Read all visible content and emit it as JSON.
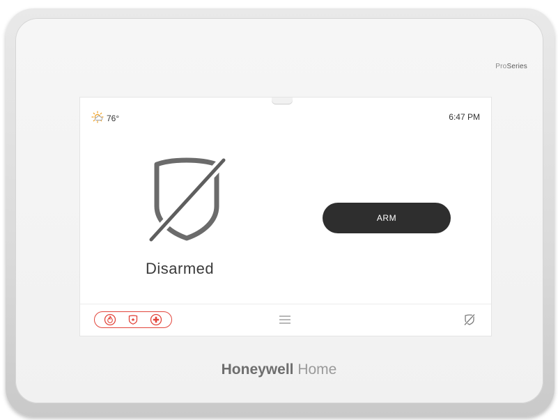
{
  "device": {
    "model_prefix": "Pro",
    "model_suffix": "Series",
    "brand_strong": "Honeywell",
    "brand_light": " Home"
  },
  "screen": {
    "weather": {
      "icon": "sun-cloud-icon",
      "temperature": "76°"
    },
    "time": "6:47 PM",
    "status": {
      "icon": "disarmed-shield-icon",
      "label": "Disarmed"
    },
    "arm_button": {
      "label": "ARM"
    },
    "bottom_bar": {
      "emergency_buttons": [
        {
          "icon": "fire-icon"
        },
        {
          "icon": "police-shield-icon"
        },
        {
          "icon": "medical-cross-icon"
        }
      ],
      "menu_icon": "hamburger-menu-icon",
      "status_icon": "disarmed-small-icon"
    }
  },
  "colors": {
    "emergency": "#e2443a",
    "arm_button": "#2e2e2e",
    "weather_icon": "#f0a020"
  }
}
